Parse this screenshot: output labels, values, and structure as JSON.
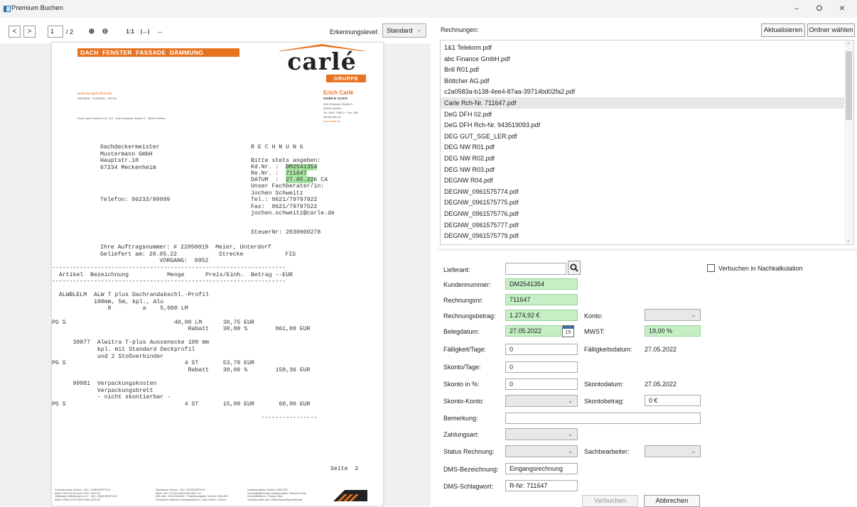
{
  "window": {
    "title": "Premium Buchen",
    "min": "–",
    "max": "ⵔ",
    "close": "✕"
  },
  "viewer_toolbar": {
    "prev": "<",
    "next": ">",
    "page_current": "1",
    "page_total": "/ 2",
    "zoom_in": "⊕",
    "zoom_out": "⊖",
    "actual_size": "1:1",
    "fit_page": "|↔|",
    "fit_width": "↔",
    "level_label": "Erkennungslevel:",
    "level_value": "Standard"
  },
  "document": {
    "banner": "DACH  FENSTER  FASSADE  DÄMMUNG",
    "logo_main": "carlé",
    "logo_sub": "GRUPPE",
    "left_small_1": "Bedachungsfachhandel",
    "left_small_2": "GIESSEN · HUNGEN · KIRTEL",
    "sender_line": "Erich Carlé GmbH & Co. KG · Karl-Glöckner-Straße 9 · 35394 Gießen",
    "company_name": "Erich Carlé",
    "company_form": "GmbH & Co.KG",
    "company_street": "Karl-Glöckner-Straße 9",
    "company_city": "35394 Gießen",
    "company_tel": "Tel. 0641 7955-0 · Fax -560",
    "company_mail": "info@carle.de",
    "company_web": "www.carle.de",
    "recipient": "Dachdeckermeister\nMustermann GmbH\nHauptstr.10\n67234 Meckenheim",
    "telefon": "Telefon: 06233/99999",
    "rechnung_title": "R E C H N U N G",
    "info_1": "Bitte stets angeben:",
    "info_kd_label": "Kd.Nr. :  ",
    "info_kd_value": "DM2541354",
    "info_re_label": "Re.Nr. :  ",
    "info_re_value": "711647",
    "info_datum_label": "DATUM  :  ",
    "info_datum_value": "27.05.22",
    "info_datum_suffix": "K CA",
    "info_rest": "Unser Fachberater/in:\nJochen Schweitz\nTel.: 0621/79797922\nFax:  0621/79797522\njochen.schweitz@carle.de",
    "steuer": "SteuerNr: 2030900278",
    "auftrag": "Ihre Auftragsnummer: # 22050019  Meier, Unterdorf\nGeliefert am: 20.05.22            Strecke            FIS\n                 VORGANG:  0952",
    "table_header": "-------------------------------------------------------------------\n  Artikel  Bezeichnung           Menge      Preis/Einh.  Betrag --EUR\n-------------------------------------------------------------------",
    "items": "\n\n  ALWBLELM  ALW T plus Dachrandabschl.-Profil\n            100mm, 5m, kpl., Alu\n                8         a    5,000 LM\n\nPG S                               40,00 LM      30,75 EUR\n                                       Rabatt    30,00 %        861,00 EUR\n\n      39877  Alwitra T-plus Aussenecke 100 mm\n             kpl. mit Standard Deckprofil\n             und 2 Stoßverbinder\nPG S                                  4 ST       53,70 EUR\n                                       Rabatt    30,00 %        150,36 EUR\n\n      99981  Verpackungskosten\n             Verpackungsbrett\n             - nicht skontierbar -\nPG S                                  4 ST       15,00 EUR       60,00 EUR\n\n                                                            ----------------",
    "seite": "Seite  2",
    "footer_1": "Commerzbank Gießen · BIC: COBADEFFXXX\nIBAN: DE20 5134 0013 0231 7000 00\nVolksbank Mittelhessen e.G. · BIC: VBMHDE5FXXX\nIBAN: DE86 5139 0000 0050 4200 00",
    "footer_2": "Sparkasse Gießen · BIC: SKGIDE5FXXX\nIBAN: DE77 5135 0025 0200 5097 23\nUSt-IdNr.: DE112644287 · Handelsregister Gießen HRA 455\nPersönlich haftende Gesellschafterin: Carlé GmbH, Gießen",
    "footer_3": "Handelsregister Gießen HRB 283\nGeschäftsführende Gesellschafter: Richard Carlé\nGeschäftsführer: Torsten Bies\nGesellschafter der COBA Baustoffgesellschaft",
    "footer_logo": "COBA"
  },
  "right_panel": {
    "rechnungen_label": "Rechnungen:",
    "refresh_button": "Aktualisieren",
    "folder_button": "Ordner wählen",
    "files": [
      "1&1 Telekom.pdf",
      "abc Finance GmbH.pdf",
      "Brill R01.pdf",
      "Böttcher AG.pdf",
      "c2a0583a-b138-4ee4-87aa-39714bd02fa2.pdf",
      "Carle Rch-Nr. 711647.pdf",
      "DeG DFH 02.pdf",
      "DeG DFH Rch-Nr. 943519093.pdf",
      "DEG GUT_SGE_LER.pdf",
      "DEG NW R01.pdf",
      "DEG NW R02.pdf",
      "DEG NW R03.pdf",
      "DEGNW R04.pdf",
      "DEGNW_0961575774.pdf",
      "DEGNW_0961575775.pdf",
      "DEGNW_0961575776.pdf",
      "DEGNW_0961575777.pdf",
      "DEGNW_0961575779.pdf"
    ],
    "selected_file": "Carle Rch-Nr. 711647.pdf"
  },
  "form": {
    "lieferant_label": "Lieferant:",
    "lieferant_value": "",
    "nachkalkulation_label": "Verbuchen in Nachkalkulation",
    "kundennummer_label": "Kundennummer:",
    "kundennummer_value": "DM2541354",
    "rechnungsnr_label": "Rechnungsnr:",
    "rechnungsnr_value": "711647",
    "rechnungsbetrag_label": "Rechnungsbetrag:",
    "rechnungsbetrag_value": "1.274,92 €",
    "konto_label": "Konto:",
    "belegdatum_label": "Belegdatum:",
    "belegdatum_value": "27.05.2022",
    "calendar_day": "15",
    "mwst_label": "MWST:",
    "mwst_value": "19,00 %",
    "faelligkeit_label": "Fälligkeit/Tage:",
    "faelligkeit_value": "0",
    "faelligkeitsdatum_label": "Fälligkeitsdatum:",
    "faelligkeitsdatum_value": "27.05.2022",
    "skonto_tage_label": "Skonto/Tage:",
    "skonto_tage_value": "0",
    "skonto_prozent_label": "Skonto in %:",
    "skonto_prozent_value": "0",
    "skontodatum_label": "Skontodatum:",
    "skontodatum_value": "27.05.2022",
    "skonto_konto_label": "Skonto-Konto:",
    "skontobetrag_label": "Skontobetrag:",
    "skontobetrag_value": "0 €",
    "bemerkung_label": "Bemerkung:",
    "bemerkung_value": "",
    "zahlungsart_label": "Zahlungsart:",
    "status_label": "Status Rechnung:",
    "sachbearbeiter_label": "Sachbearbeiter:",
    "dms_bezeichnung_label": "DMS-Bezeichnung:",
    "dms_bezeichnung_value": "Eingangsrechnung",
    "dms_schlagwort_label": "DMS-Schlagwort:",
    "dms_schlagwort_value": "R-Nr: 711647",
    "verbuchen_button": "Verbuchen",
    "abbrechen_button": "Abbrechen"
  },
  "colors": {
    "green_field": "#c6efc6",
    "carle_orange": "#e8731f",
    "highlight": "#a9e5a3"
  }
}
